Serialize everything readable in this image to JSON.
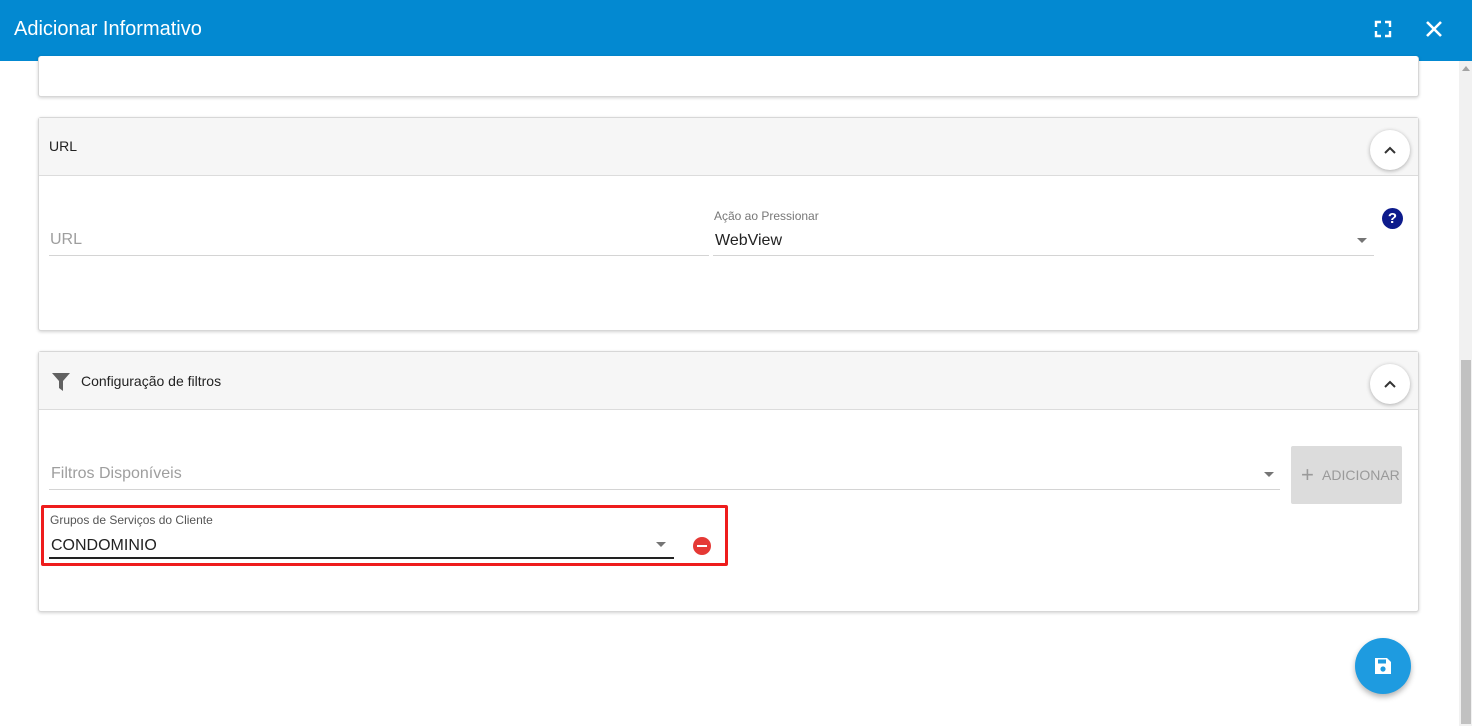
{
  "dialog": {
    "title": "Adicionar Informativo"
  },
  "url_section": {
    "title": "URL",
    "url_field": {
      "placeholder": "URL",
      "value": ""
    },
    "action_field": {
      "label": "Ação ao Pressionar",
      "value": "WebView"
    },
    "help_symbol": "?"
  },
  "filters_section": {
    "title": "Configuração de filtros",
    "available_filters": {
      "placeholder": "Filtros Disponíveis"
    },
    "add_button": {
      "icon": "+",
      "label": "ADICIONAR"
    },
    "group_filter": {
      "label": "Grupos de Serviços do Cliente",
      "value": "CONDOMINIO"
    }
  },
  "colors": {
    "header_blue": "#0389d1",
    "fab_blue": "#1e9be0",
    "highlight_red": "#ee1c1c",
    "remove_red": "#e53935",
    "help_navy": "#0d1b8c"
  },
  "icons": {
    "fullscreen": "fullscreen-icon",
    "close": "close-icon",
    "collapse": "chevron-up-icon",
    "filter": "filter-icon",
    "help": "help-icon",
    "remove": "remove-circle-icon",
    "save": "save-icon"
  }
}
